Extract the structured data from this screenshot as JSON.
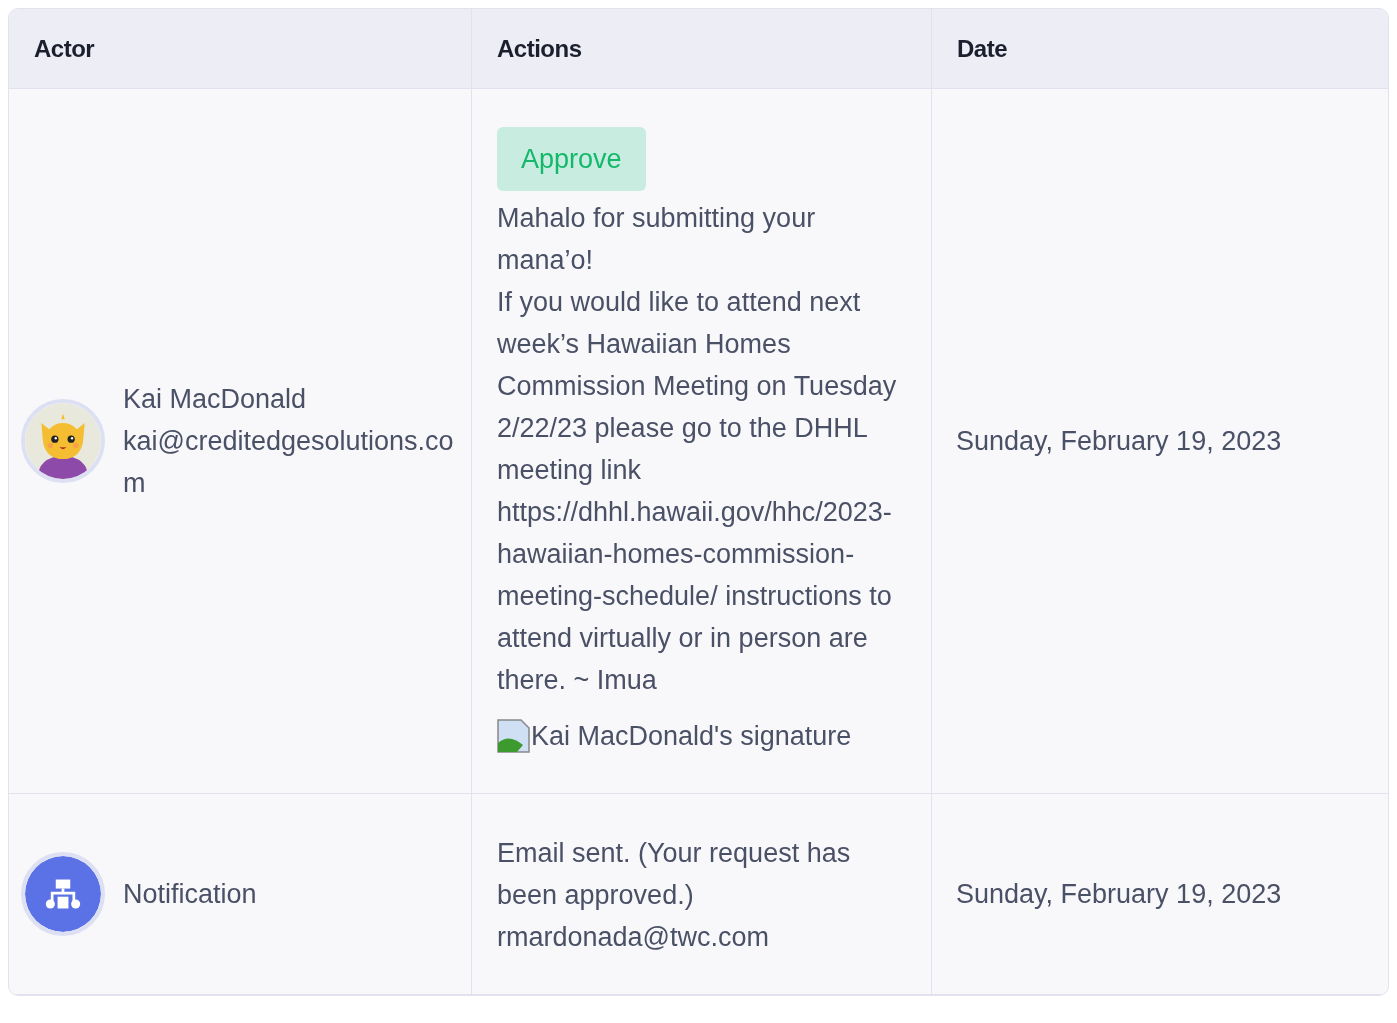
{
  "table": {
    "columns": [
      "Actor",
      "Actions",
      "Date"
    ],
    "rows": [
      {
        "actor": {
          "kind": "user",
          "lines": [
            "Kai MacDonald",
            "kai@creditedgesolutions.com"
          ]
        },
        "actions": [
          {
            "kind": "badge",
            "text": "Approve"
          },
          {
            "kind": "text",
            "text": "Mahalo for submitting your mana’o!"
          },
          {
            "kind": "text",
            "text": "If you would like to attend next week’s Hawaiian Homes Commission Meeting on Tuesday 2/22/23 please go to the DHHL meeting link https://dhhl.hawaii.gov/hhc/2023-hawaiian-homes-commission-meeting-schedule/ instructions to attend virtually or in person are there. ~ Imua"
          },
          {
            "kind": "image",
            "text": "Kai MacDonald's signature"
          }
        ],
        "date": "Sunday, February 19, 2023"
      },
      {
        "actor": {
          "kind": "system",
          "lines": [
            "Notification"
          ]
        },
        "actions": [
          {
            "kind": "text",
            "text": "Email sent. (Your request has been approved.) rmardonada@twc.com"
          }
        ],
        "date": "Sunday, February 19, 2023"
      }
    ]
  }
}
